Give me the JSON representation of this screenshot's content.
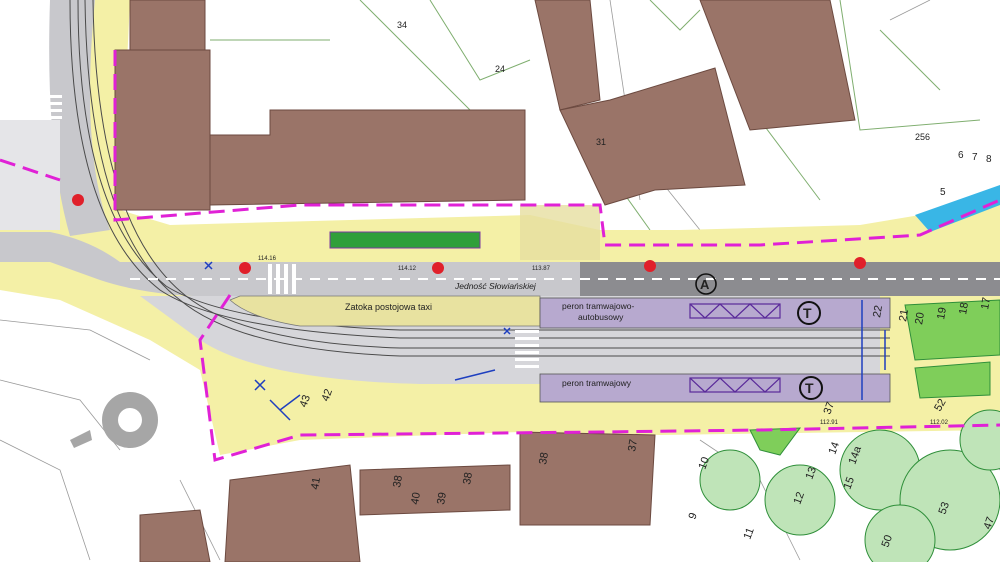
{
  "map": {
    "street_name": "Jedność Słowiańskiej",
    "labels": {
      "taxi_bay": "Zatoka postojowa taxi",
      "tram_bus_platform_line1": "peron tramwajowo-",
      "tram_bus_platform_line2": "autobusowy",
      "tram_platform": "peron tramwajowy"
    },
    "symbols": {
      "bus_stop": "A",
      "tram_stop_top": "T",
      "tram_stop_bottom": "T"
    },
    "parcel_numbers": [
      "24",
      "34",
      "31",
      "256",
      "5",
      "6",
      "7",
      "8"
    ],
    "tree_numbers": [
      "42",
      "43",
      "41",
      "38",
      "40",
      "39",
      "38",
      "38",
      "37",
      "22",
      "21",
      "20",
      "19",
      "18",
      "17",
      "52",
      "37",
      "10",
      "9",
      "11",
      "12",
      "13",
      "14",
      "14a",
      "15",
      "50",
      "53",
      "47"
    ],
    "elevations": [
      "114.16",
      "114.12",
      "113.87",
      "112.91",
      "112.02"
    ],
    "colors": {
      "building": "#9a7468",
      "sidewalk": "#f4f0a6",
      "road": "#c8c8cc",
      "dark_road": "#8c8c90",
      "platform": "#b7a9cf",
      "boundary": "#e021d6",
      "greenery": "#2f9f3a",
      "water": "#39b6e6"
    }
  }
}
